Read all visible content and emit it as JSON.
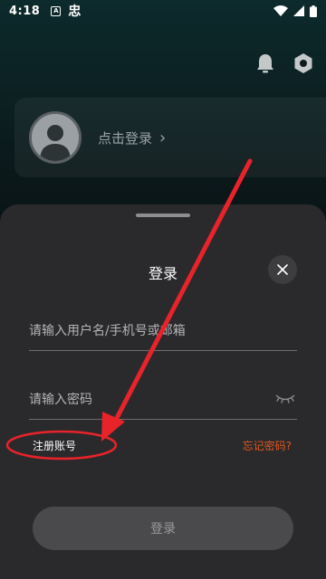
{
  "status_bar": {
    "time": "4:18",
    "notification_glyph": "忠"
  },
  "profile": {
    "login_prompt": "点击登录",
    "chevron": "›"
  },
  "login_sheet": {
    "title": "登录",
    "username_placeholder": "请输入用户名/手机号或邮箱",
    "password_placeholder": "请输入密码",
    "register_label": "注册账号",
    "forgot_label": "忘记密码?",
    "submit_label": "登录"
  },
  "icons": {
    "bell": "bell-icon",
    "settings": "settings-hex-icon",
    "close": "close-icon",
    "eye": "eye-closed-icon",
    "avatar": "avatar-placeholder"
  },
  "colors": {
    "accent_orange": "#e2571e",
    "annotation_red": "#e8232a",
    "sheet_bg": "#2a2a2c"
  }
}
